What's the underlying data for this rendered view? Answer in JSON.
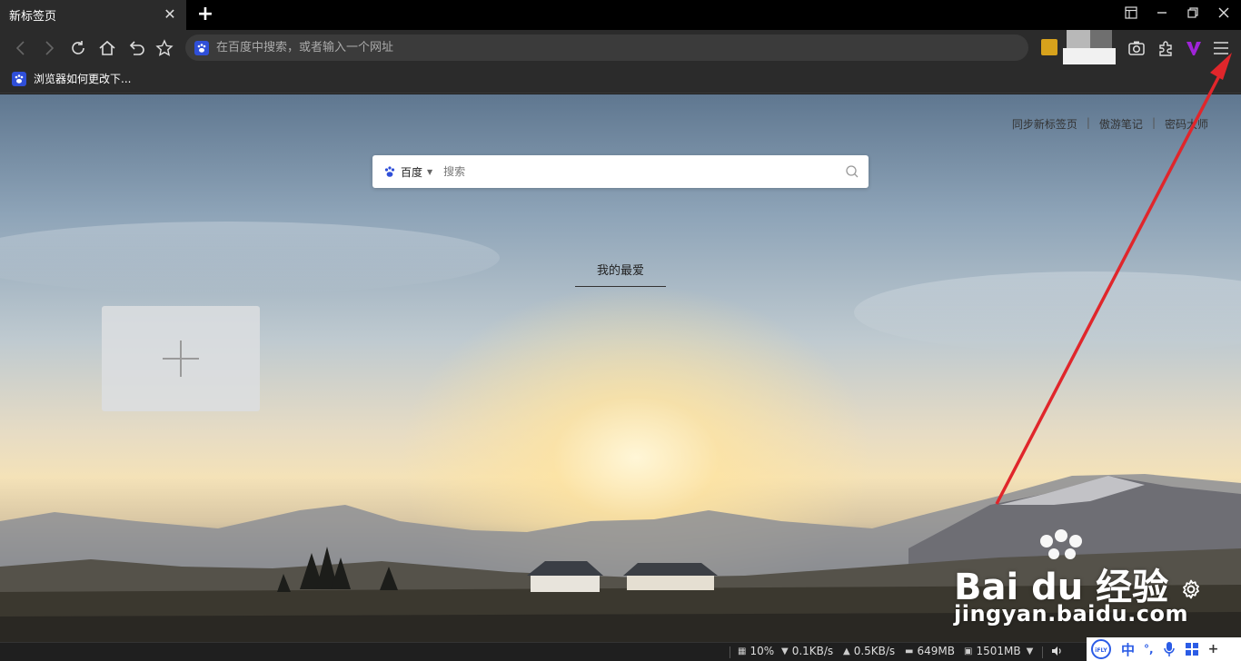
{
  "tab": {
    "title": "新标签页",
    "close": "✕",
    "new_tab": "+"
  },
  "window_controls": {
    "snap": "▭",
    "minimize": "—",
    "restore": "❐",
    "close": "✕"
  },
  "address_bar": {
    "placeholder": "在百度中搜索，或者输入一个网址"
  },
  "bookmarks": [
    {
      "label": "浏览器如何更改下..."
    }
  ],
  "content": {
    "top_links": [
      "同步新标签页",
      "傲游笔记",
      "密码大师"
    ],
    "search_engine": "百度",
    "search_placeholder": "搜索",
    "favorites_title": "我的最爱"
  },
  "watermark": {
    "brand": "Bai du 经验",
    "url": "jingyan.baidu.com"
  },
  "status_bar": {
    "cpu": "10%",
    "download": "0.1KB/s",
    "upload": "0.5KB/s",
    "memory": "649MB",
    "memory2": "1501MB"
  },
  "ime": {
    "label": "iFLY",
    "mode": "中",
    "punct": "°,"
  },
  "colors": {
    "arrow": "#e0262b",
    "accent": "#2f4fd8",
    "ime": "#2b5ce6"
  }
}
